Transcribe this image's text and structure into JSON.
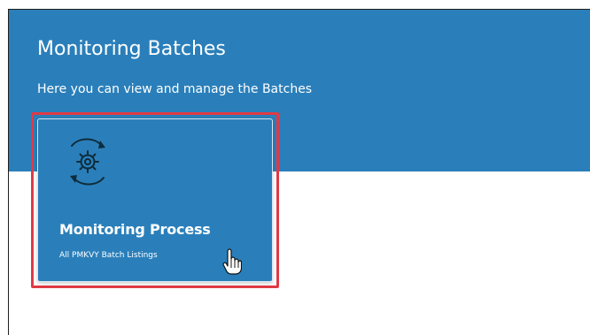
{
  "header": {
    "title": "Monitoring Batches",
    "subtitle": "Here you can view and manage the Batches"
  },
  "card": {
    "title": "Monitoring Process",
    "subtitle": "All PMKVY Batch Listings",
    "icon": "gear-refresh-icon"
  },
  "colors": {
    "banner": "#2a7fba",
    "card": "#2a7fba",
    "highlight": "#e03a45",
    "text": "#ffffff"
  },
  "cursor": {
    "icon": "hand-pointer-icon"
  }
}
